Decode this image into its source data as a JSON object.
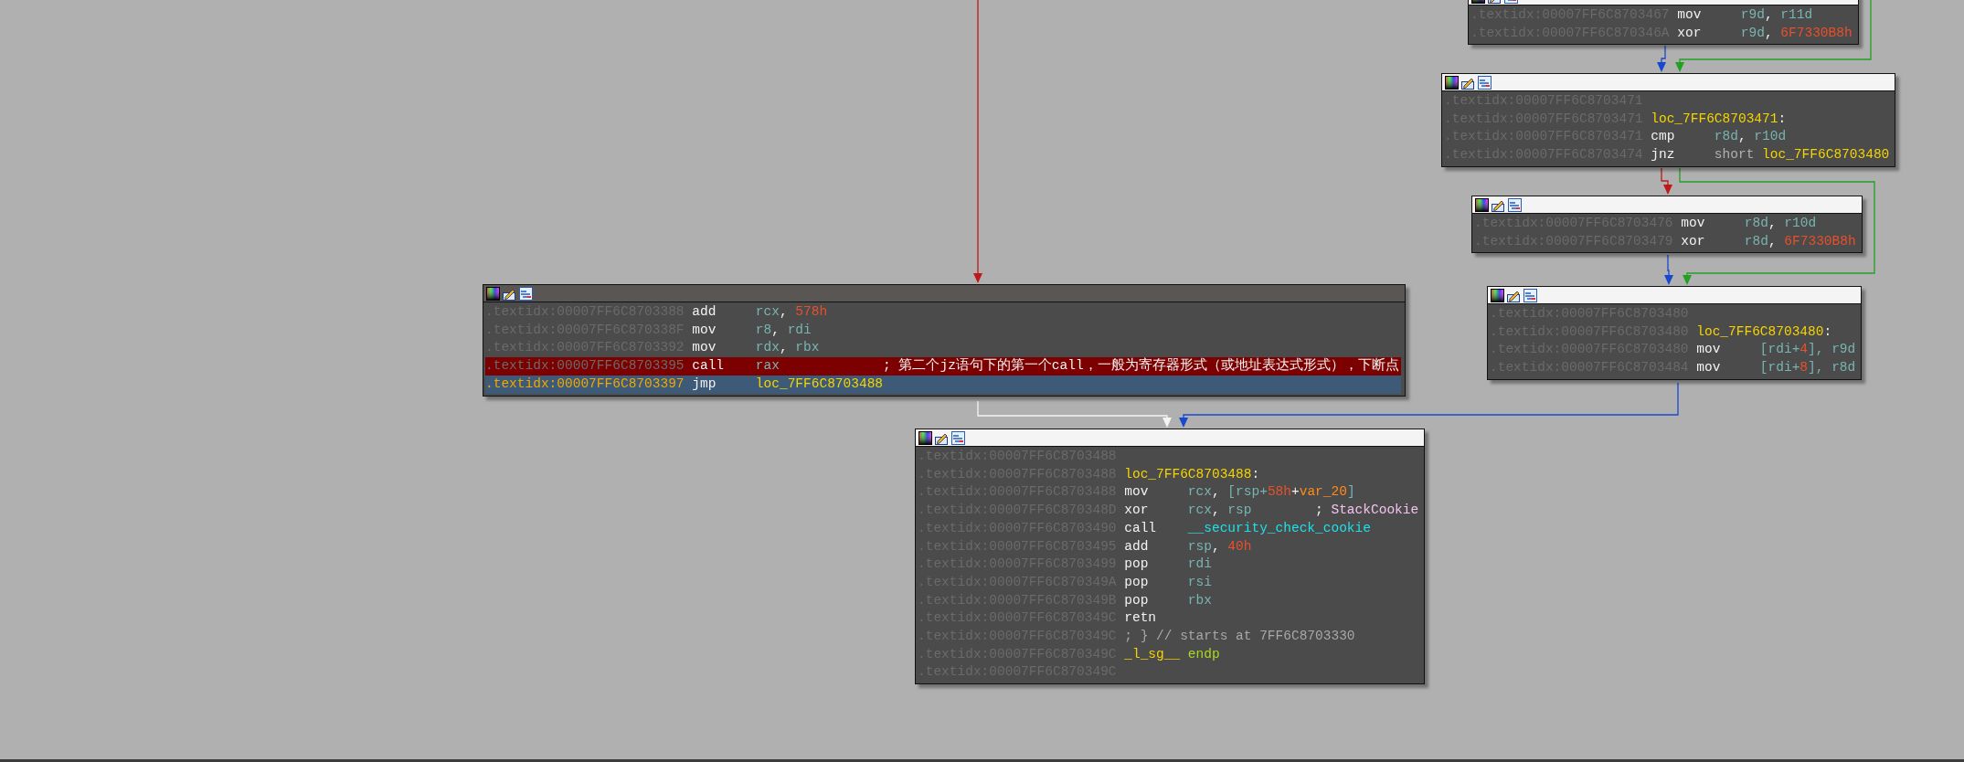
{
  "nodes": [
    {
      "selected": false,
      "lines": [
        {
          "address": ".textidx:00007FF6C8703467",
          "mnemonic": "mov",
          "operands": [
            {
              "text": "r9d",
              "kind": "reg"
            },
            {
              "text": ", ",
              "kind": "punct"
            },
            {
              "text": "r11d",
              "kind": "reg"
            }
          ],
          "breakpoint": false,
          "selected": false
        },
        {
          "address": ".textidx:00007FF6C870346A",
          "mnemonic": "xor",
          "operands": [
            {
              "text": "r9d",
              "kind": "reg"
            },
            {
              "text": ", ",
              "kind": "punct"
            },
            {
              "text": "6F7330B8h",
              "kind": "num"
            }
          ],
          "breakpoint": false,
          "selected": false
        }
      ]
    },
    {
      "selected": false,
      "lines": [
        {
          "address": ".textidx:00007FF6C8703471",
          "breakpoint": false,
          "selected": false
        },
        {
          "address": ".textidx:00007FF6C8703471",
          "operands": [
            {
              "text": "loc_7FF6C8703471",
              "kind": "label"
            },
            {
              "text": ":",
              "kind": "punct"
            }
          ],
          "breakpoint": false,
          "selected": false
        },
        {
          "address": ".textidx:00007FF6C8703471",
          "mnemonic": "cmp",
          "operands": [
            {
              "text": "r8d",
              "kind": "reg"
            },
            {
              "text": ", ",
              "kind": "punct"
            },
            {
              "text": "r10d",
              "kind": "reg"
            }
          ],
          "breakpoint": false,
          "selected": false
        },
        {
          "address": ".textidx:00007FF6C8703474",
          "mnemonic": "jnz",
          "operands": [
            {
              "text": "short ",
              "kind": "keyword"
            },
            {
              "text": "loc_7FF6C8703480",
              "kind": "label"
            }
          ],
          "breakpoint": false,
          "selected": false
        }
      ]
    },
    {
      "selected": false,
      "lines": [
        {
          "address": ".textidx:00007FF6C8703476",
          "mnemonic": "mov",
          "operands": [
            {
              "text": "r8d",
              "kind": "reg"
            },
            {
              "text": ", ",
              "kind": "punct"
            },
            {
              "text": "r10d",
              "kind": "reg"
            }
          ],
          "breakpoint": false,
          "selected": false
        },
        {
          "address": ".textidx:00007FF6C8703479",
          "mnemonic": "xor",
          "operands": [
            {
              "text": "r8d",
              "kind": "reg"
            },
            {
              "text": ", ",
              "kind": "punct"
            },
            {
              "text": "6F7330B8h",
              "kind": "num"
            }
          ],
          "breakpoint": false,
          "selected": false
        }
      ]
    },
    {
      "selected": true,
      "lines": [
        {
          "address": ".textidx:00007FF6C8703388",
          "mnemonic": "add",
          "operands": [
            {
              "text": "rcx",
              "kind": "reg"
            },
            {
              "text": ", ",
              "kind": "punct"
            },
            {
              "text": "578h",
              "kind": "num"
            }
          ],
          "breakpoint": false,
          "selected": false
        },
        {
          "address": ".textidx:00007FF6C870338F",
          "mnemonic": "mov",
          "operands": [
            {
              "text": "r8",
              "kind": "reg"
            },
            {
              "text": ", ",
              "kind": "punct"
            },
            {
              "text": "rdi",
              "kind": "reg"
            }
          ],
          "breakpoint": false,
          "selected": false
        },
        {
          "address": ".textidx:00007FF6C8703392",
          "mnemonic": "mov",
          "operands": [
            {
              "text": "rdx",
              "kind": "reg"
            },
            {
              "text": ", ",
              "kind": "punct"
            },
            {
              "text": "rbx",
              "kind": "reg"
            }
          ],
          "breakpoint": false,
          "selected": false
        },
        {
          "address": ".textidx:00007FF6C8703395",
          "mnemonic": "call",
          "operands": [
            {
              "text": "rax",
              "kind": "reg"
            }
          ],
          "comment": [
            {
              "text": "; 第二个jz语句下的第一个call，一般为寄存器形式（或地址表达式形式），下断点",
              "kind": "punct"
            }
          ],
          "breakpoint": true,
          "selected": false
        },
        {
          "address": ".textidx:00007FF6C8703397",
          "mnemonic": "jmp",
          "operands": [
            {
              "text": "loc_7FF6C8703488",
              "kind": "label"
            }
          ],
          "breakpoint": false,
          "selected": true
        }
      ]
    },
    {
      "selected": false,
      "lines": [
        {
          "address": ".textidx:00007FF6C8703480",
          "breakpoint": false,
          "selected": false
        },
        {
          "address": ".textidx:00007FF6C8703480",
          "operands": [
            {
              "text": "loc_7FF6C8703480",
              "kind": "label"
            },
            {
              "text": ":",
              "kind": "punct"
            }
          ],
          "breakpoint": false,
          "selected": false
        },
        {
          "address": ".textidx:00007FF6C8703480",
          "mnemonic": "mov",
          "operands": [
            {
              "text": "[rdi+",
              "kind": "reg"
            },
            {
              "text": "4",
              "kind": "num"
            },
            {
              "text": "], ",
              "kind": "reg"
            },
            {
              "text": "r9d",
              "kind": "reg"
            }
          ],
          "breakpoint": false,
          "selected": false
        },
        {
          "address": ".textidx:00007FF6C8703484",
          "mnemonic": "mov",
          "operands": [
            {
              "text": "[rdi+",
              "kind": "reg"
            },
            {
              "text": "8",
              "kind": "num"
            },
            {
              "text": "], ",
              "kind": "reg"
            },
            {
              "text": "r8d",
              "kind": "reg"
            }
          ],
          "breakpoint": false,
          "selected": false
        }
      ]
    },
    {
      "selected": false,
      "lines": [
        {
          "address": ".textidx:00007FF6C8703488",
          "breakpoint": false,
          "selected": false
        },
        {
          "address": ".textidx:00007FF6C8703488",
          "operands": [
            {
              "text": "loc_7FF6C8703488",
              "kind": "label"
            },
            {
              "text": ":",
              "kind": "punct"
            }
          ],
          "breakpoint": false,
          "selected": false
        },
        {
          "address": ".textidx:00007FF6C8703488",
          "mnemonic": "mov",
          "operands": [
            {
              "text": "rcx",
              "kind": "reg"
            },
            {
              "text": ", ",
              "kind": "punct"
            },
            {
              "text": "[rsp+",
              "kind": "reg"
            },
            {
              "text": "58h",
              "kind": "num"
            },
            {
              "text": "+",
              "kind": "punct"
            },
            {
              "text": "var_20",
              "kind": "var"
            },
            {
              "text": "]",
              "kind": "reg"
            }
          ],
          "breakpoint": false,
          "selected": false
        },
        {
          "address": ".textidx:00007FF6C870348D",
          "mnemonic": "xor",
          "operands": [
            {
              "text": "rcx",
              "kind": "reg"
            },
            {
              "text": ", ",
              "kind": "punct"
            },
            {
              "text": "rsp",
              "kind": "reg"
            }
          ],
          "comment": [
            {
              "text": "; ",
              "kind": "punct"
            },
            {
              "text": "StackCookie",
              "kind": "symref"
            }
          ],
          "breakpoint": false,
          "selected": false
        },
        {
          "address": ".textidx:00007FF6C8703490",
          "mnemonic": "call",
          "operands": [
            {
              "text": "__security_check_cookie",
              "kind": "func"
            }
          ],
          "breakpoint": false,
          "selected": false
        },
        {
          "address": ".textidx:00007FF6C8703495",
          "mnemonic": "add",
          "operands": [
            {
              "text": "rsp",
              "kind": "reg"
            },
            {
              "text": ", ",
              "kind": "punct"
            },
            {
              "text": "40h",
              "kind": "num"
            }
          ],
          "breakpoint": false,
          "selected": false
        },
        {
          "address": ".textidx:00007FF6C8703499",
          "mnemonic": "pop",
          "operands": [
            {
              "text": "rdi",
              "kind": "reg"
            }
          ],
          "breakpoint": false,
          "selected": false
        },
        {
          "address": ".textidx:00007FF6C870349A",
          "mnemonic": "pop",
          "operands": [
            {
              "text": "rsi",
              "kind": "reg"
            }
          ],
          "breakpoint": false,
          "selected": false
        },
        {
          "address": ".textidx:00007FF6C870349B",
          "mnemonic": "pop",
          "operands": [
            {
              "text": "rbx",
              "kind": "reg"
            }
          ],
          "breakpoint": false,
          "selected": false
        },
        {
          "address": ".textidx:00007FF6C870349C",
          "mnemonic": "retn",
          "breakpoint": false,
          "selected": false
        },
        {
          "address": ".textidx:00007FF6C870349C",
          "operands": [
            {
              "text": "; } // starts at 7FF6C8703330",
              "kind": "remark"
            }
          ],
          "breakpoint": false,
          "selected": false
        },
        {
          "address": ".textidx:00007FF6C870349C",
          "operands": [
            {
              "text": "_l_sg__",
              "kind": "label"
            },
            {
              "text": " endp",
              "kind": "endp"
            }
          ],
          "breakpoint": false,
          "selected": false
        },
        {
          "address": ".textidx:00007FF6C870349C",
          "breakpoint": false,
          "selected": false
        }
      ]
    }
  ],
  "edges": [
    {
      "kind": "false"
    },
    {
      "kind": "next"
    },
    {
      "kind": "true"
    },
    {
      "kind": "false"
    },
    {
      "kind": "true"
    },
    {
      "kind": "next"
    },
    {
      "kind": "highlighted"
    },
    {
      "kind": "next"
    }
  ]
}
